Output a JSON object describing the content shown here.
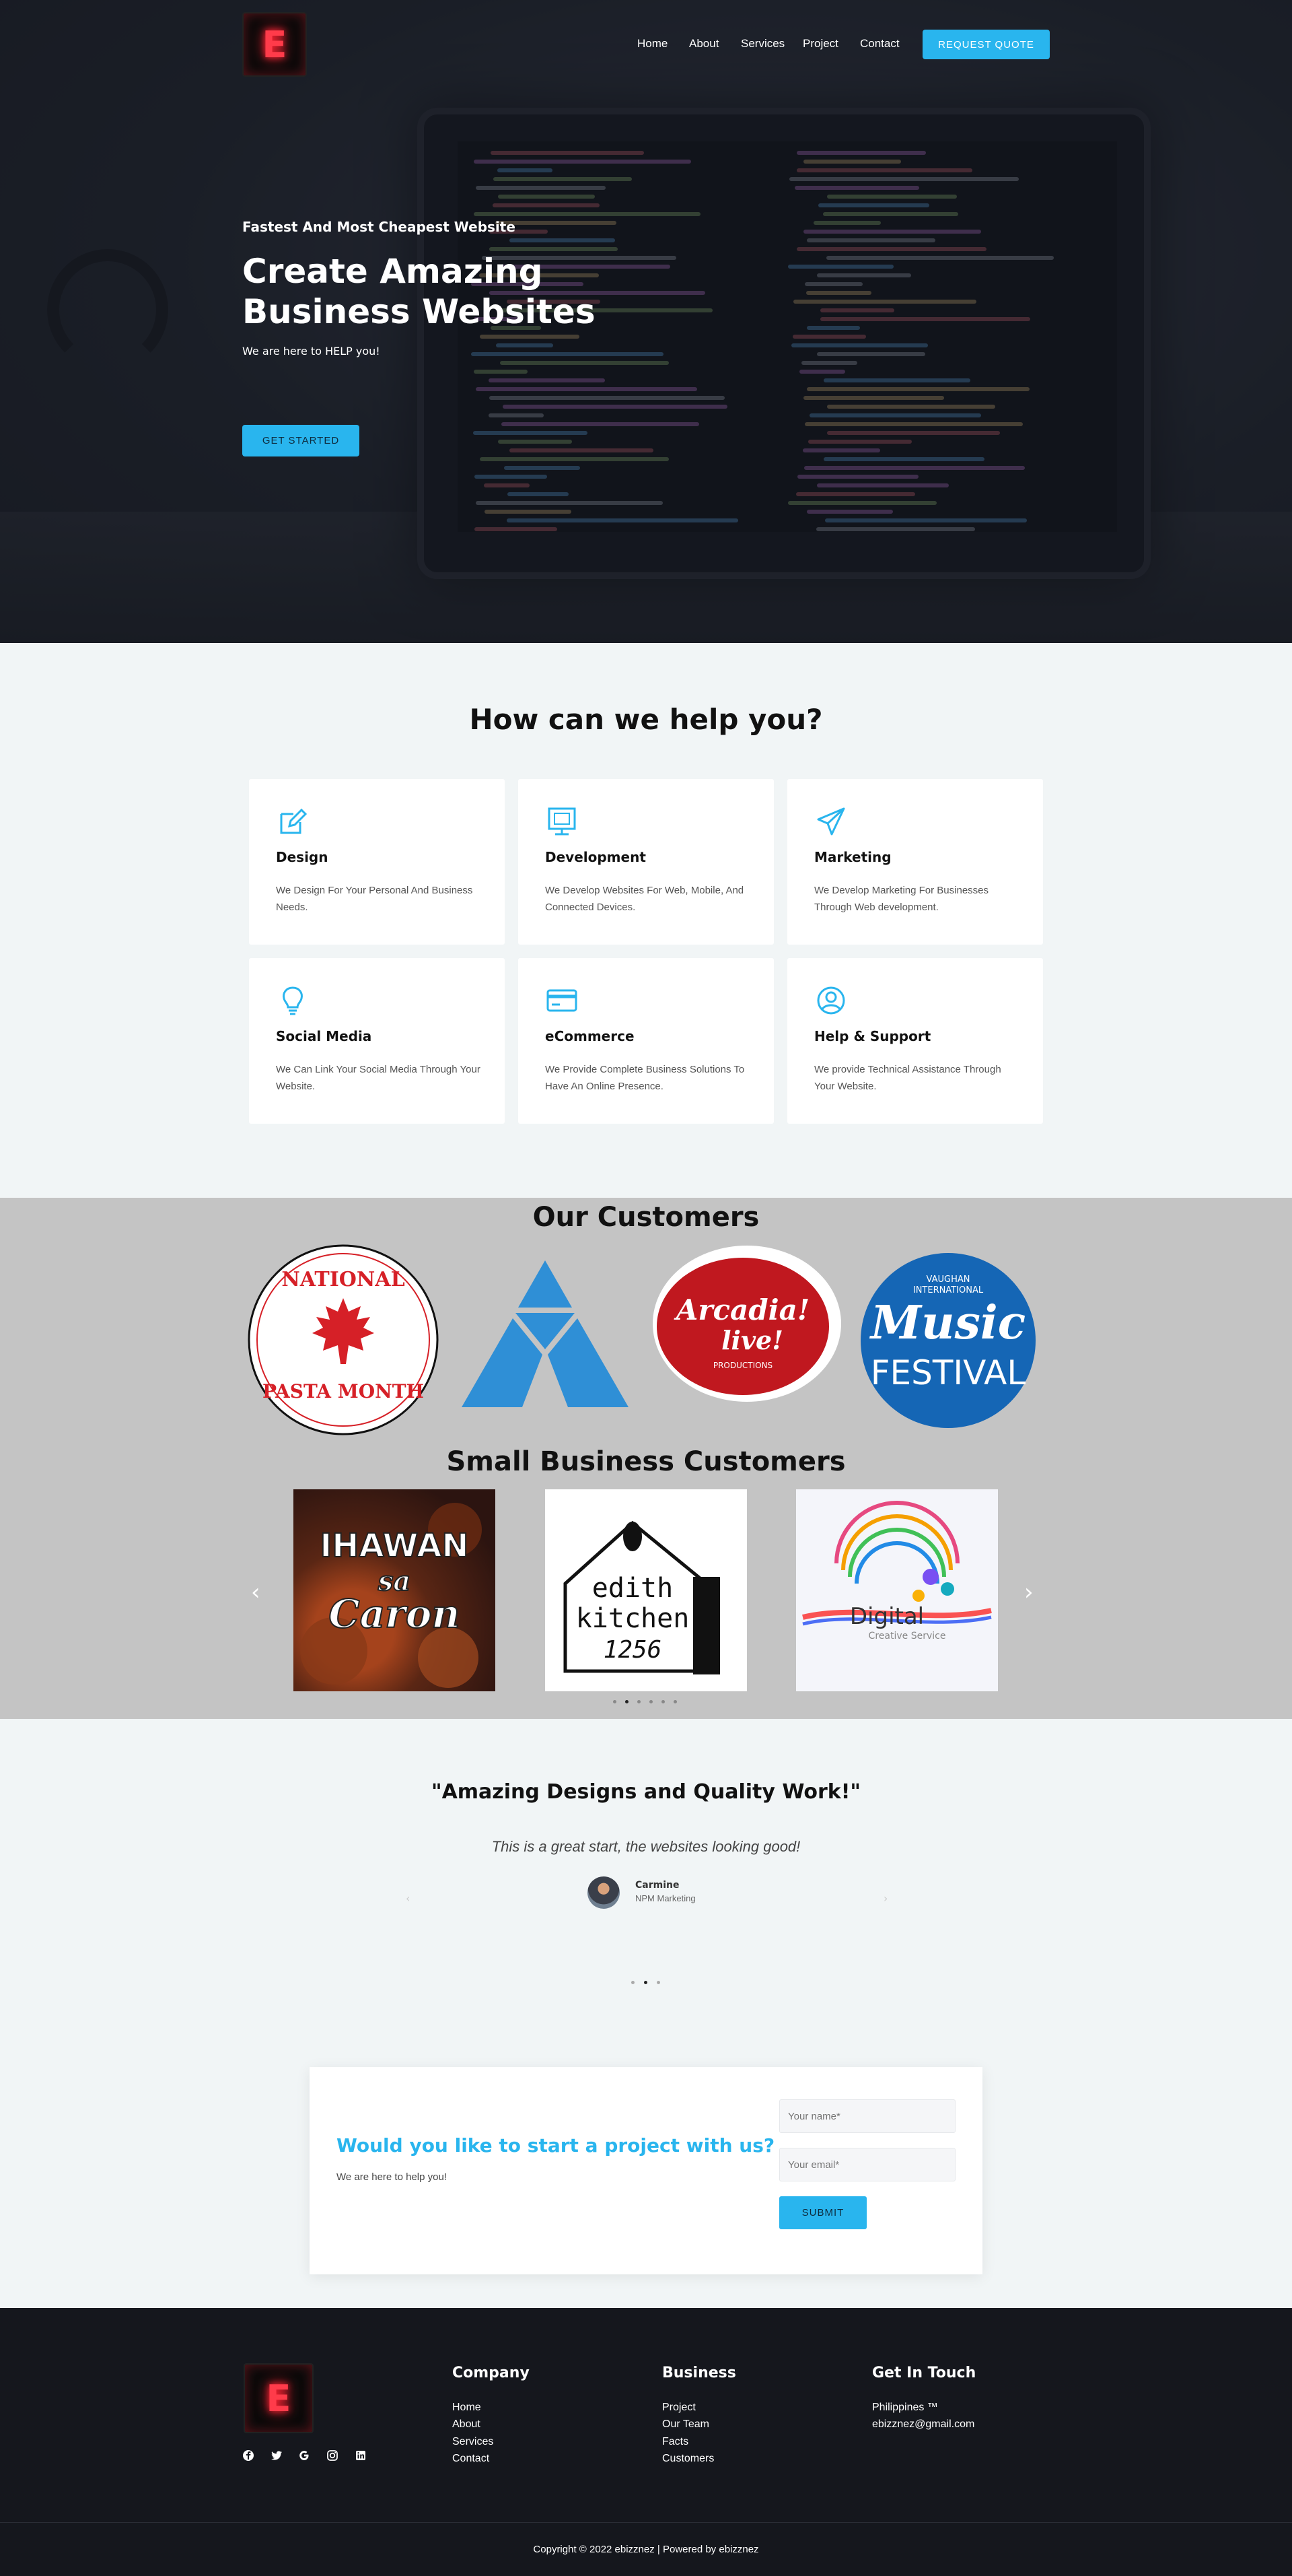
{
  "header": {
    "logo_letter": "E",
    "nav": [
      "Home",
      "About",
      "Services",
      "Project",
      "Contact"
    ],
    "quote_button": "REQUEST QUOTE"
  },
  "hero": {
    "kicker": "Fastest And Most Cheapest Website",
    "title_line1": "Create Amazing",
    "title_line2": "Business Websites",
    "subtitle": "We are here to HELP you!",
    "cta": "GET STARTED"
  },
  "services": {
    "title": "How can we help you?",
    "items": [
      {
        "icon": "edit-icon",
        "title": "Design",
        "text": "We Design For Your Personal And Business Needs."
      },
      {
        "icon": "monitor-icon",
        "title": "Development",
        "text": "We Develop Websites For Web, Mobile, And Connected Devices."
      },
      {
        "icon": "paper-plane-icon",
        "title": "Marketing",
        "text": "We Develop Marketing For Businesses Through Web development."
      },
      {
        "icon": "lightbulb-icon",
        "title": "Social Media",
        "text": "We Can Link Your Social Media Through Your Website."
      },
      {
        "icon": "credit-card-icon",
        "title": "eCommerce",
        "text": "We Provide Complete Business Solutions To Have An Online Presence."
      },
      {
        "icon": "user-circle-icon",
        "title": "Help & Support",
        "text": "We provide Technical Assistance Through Your Website."
      }
    ]
  },
  "customers": {
    "title": "Our Customers",
    "logos": {
      "pasta_top": "NATIONAL",
      "pasta_bottom": "PASTA MONTH",
      "arcadia_1": "Arcadia!",
      "arcadia_2": "live!",
      "arcadia_3": "PRODUCTIONS",
      "music_1": "VAUGHAN",
      "music_2": "INTERNATIONAL",
      "music_3": "Music",
      "music_4": "FESTIVAL"
    },
    "small_title": "Small Business Customers",
    "small": {
      "ihawan_1": "IHAWAN",
      "ihawan_2": "sa",
      "ihawan_3": "Caron",
      "edith_1": "edith",
      "edith_2": "kitchen",
      "edith_3": "1256",
      "digital_1": "Digital",
      "digital_2": "Creative Service"
    },
    "prev_arrow": "‹",
    "next_arrow": "›"
  },
  "testimonial": {
    "title": "\"Amazing Designs and Quality Work!\"",
    "quote": "This is a great start, the websites looking good!",
    "name": "Carmine",
    "role": "NPM Marketing"
  },
  "cta": {
    "title": "Would you like to start a project with us?",
    "subtitle": "We are here to help you!",
    "name_placeholder": "Your name*",
    "email_placeholder": "Your email*",
    "submit": "SUBMIT"
  },
  "footer": {
    "company_title": "Company",
    "company_links": [
      "Home",
      "About",
      "Services",
      "Contact"
    ],
    "business_title": "Business",
    "business_links": [
      "Project",
      "Our Team",
      "Facts",
      "Customers"
    ],
    "contact_title": "Get In Touch",
    "country": "Philippines ™",
    "email": "ebizznez@gmail.com",
    "social": [
      "facebook-icon",
      "twitter-icon",
      "google-icon",
      "instagram-icon",
      "linkedin-icon"
    ],
    "copyright": "Copyright © 2022 ebizznez | Powered by ebizznez"
  },
  "colors": {
    "accent": "#29b5ee",
    "footer_bg": "#15171d",
    "customers_bg": "#c4c4c4"
  }
}
